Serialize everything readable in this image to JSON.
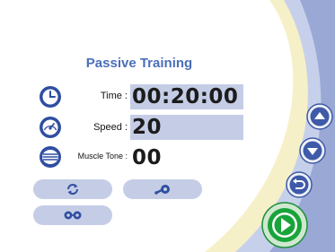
{
  "title": "Passive Training",
  "time": {
    "label": "Time :",
    "value": "00:20:00"
  },
  "speed": {
    "label": "Speed :",
    "value": "20"
  },
  "muscle_tone": {
    "label": "Muscle Tone :",
    "value": "00"
  },
  "icons": {
    "time": "clock-icon",
    "speed": "speedometer-icon",
    "muscle_tone": "muscle-tone-icon",
    "rotate": "refresh-icon",
    "pedal": "pedal-icon",
    "reverse": "reverse-pedal-icon",
    "up": "arrow-up-icon",
    "down": "arrow-down-icon",
    "back": "back-icon",
    "start": "play-icon"
  },
  "colors": {
    "accent": "#4a6fb8",
    "panel": "#c5cde6",
    "side_band": "#9aa8d6",
    "start_green": "#19a43a"
  }
}
